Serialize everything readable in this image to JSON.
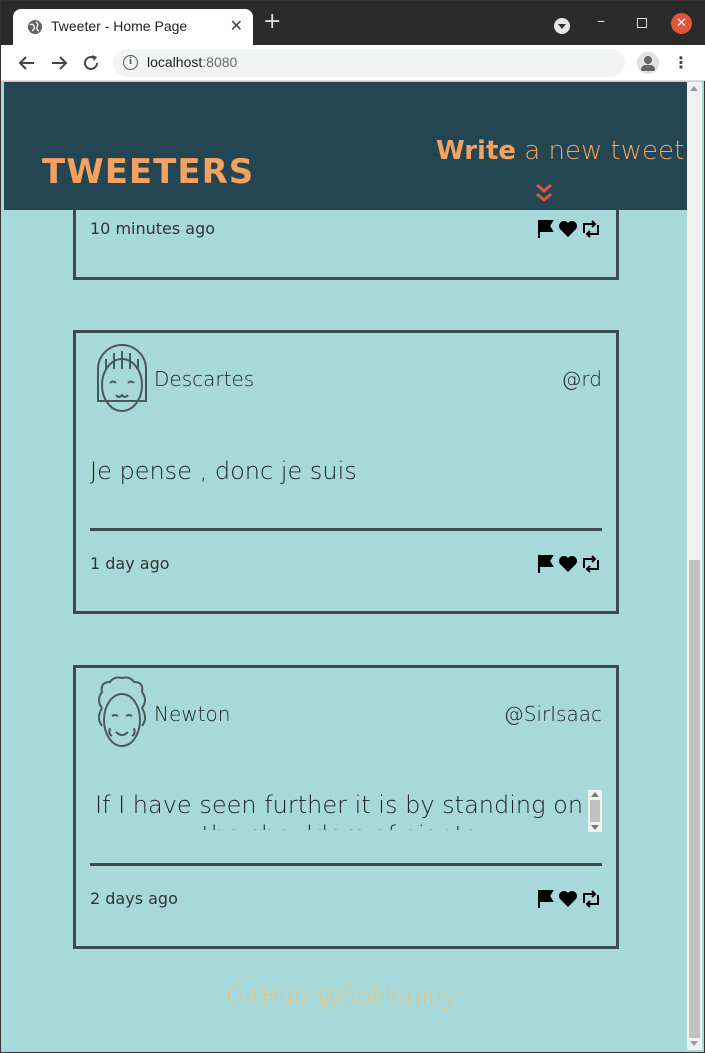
{
  "browser": {
    "tab_title": "Tweeter - Home Page",
    "tab_close": "✕",
    "new_tab": "+",
    "url_host": "localhost",
    "url_port": ":8080",
    "win_min": "–",
    "win_close": "✕"
  },
  "header": {
    "brand": "TWEETERS",
    "compose_bold": "Write",
    "compose_rest": " a new tweet"
  },
  "tweets": [
    {
      "time": "10 minutes ago"
    },
    {
      "name": "Descartes",
      "handle": "@rd",
      "content": "Je pense , donc je suis",
      "time": "1 day ago"
    },
    {
      "name": "Newton",
      "handle": "@SirIsaac",
      "content": "If I have seen further it is by standing on the shoulders of giants",
      "time": "2 days ago"
    }
  ],
  "footer": {
    "link": "GitHub:@Soliloqiuy"
  },
  "colors": {
    "page_bg": "#a8d9da",
    "header_bg": "#244552",
    "accent": "#f4a261",
    "footer_text": "#e8c27a"
  },
  "icons": [
    "globe-icon",
    "close-icon",
    "plus-icon",
    "back-icon",
    "forward-icon",
    "reload-icon",
    "info-icon",
    "star-icon",
    "profile-icon",
    "menu-icon",
    "chevron-down-icon",
    "flag-icon",
    "heart-icon",
    "retweet-icon"
  ]
}
